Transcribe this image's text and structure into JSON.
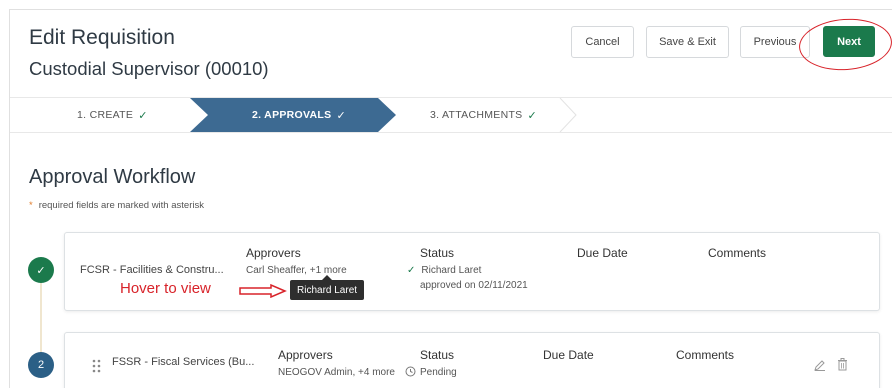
{
  "header": {
    "title": "Edit Requisition",
    "subtitle": "Custodial Supervisor (00010)",
    "buttons": {
      "cancel": "Cancel",
      "save_exit": "Save & Exit",
      "previous": "Previous",
      "next": "Next"
    }
  },
  "stepper": {
    "steps": [
      {
        "label": "1. CREATE",
        "state": "complete"
      },
      {
        "label": "2. APPROVALS",
        "state": "active"
      },
      {
        "label": "3. ATTACHMENTS",
        "state": "complete"
      }
    ]
  },
  "section": {
    "title": "Approval Workflow",
    "required_note": "required fields are marked with asterisk",
    "required_marker": "*"
  },
  "workflow": [
    {
      "badge": "✓",
      "name": "FCSR - Facilities & Constru...",
      "approvers_header": "Approvers",
      "approvers": "Carl Sheaffer, +1 more",
      "status_header": "Status",
      "status_line1": "Richard Laret",
      "status_line2": "approved on 02/11/2021",
      "due_header": "Due Date",
      "comments_header": "Comments"
    },
    {
      "badge": "2",
      "name": "FSSR - Fiscal Services (Bu...",
      "approvers_header": "Approvers",
      "approvers": "NEOGOV Admin, +4 more",
      "status_header": "Status",
      "status_line1": "Pending",
      "due_header": "Due Date",
      "comments_header": "Comments"
    }
  ],
  "tooltip": "Richard Laret",
  "annotation": {
    "hover_text": "Hover to view",
    "color": "#d8232a"
  },
  "colors": {
    "primary": "#1b7a4c",
    "active_step": "#3d6a92",
    "badge_pending": "#2b5f86"
  }
}
